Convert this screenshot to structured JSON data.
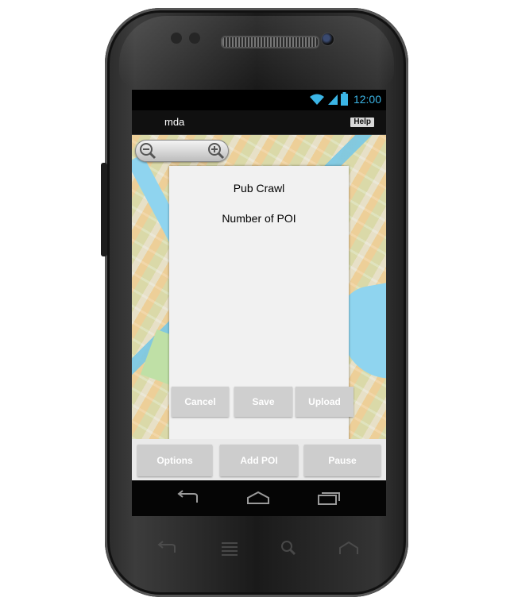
{
  "status_bar": {
    "time": "12:00",
    "icons": [
      "wifi-icon",
      "signal-icon",
      "battery-icon"
    ],
    "accent_color": "#3bb5e6"
  },
  "app_bar": {
    "title": "mda",
    "help_label": "Help"
  },
  "map": {
    "zoom_controls": [
      "zoom-out-icon",
      "zoom-in-icon"
    ]
  },
  "dialog": {
    "title": "Pub Crawl",
    "subtitle": "Number of POI",
    "buttons": {
      "cancel": "Cancel",
      "save": "Save",
      "upload": "Upload"
    }
  },
  "action_bar": {
    "options": "Options",
    "add_poi": "Add POI",
    "pause": "Pause"
  },
  "nav_bar": {
    "icons": [
      "back-icon",
      "home-icon",
      "recent-apps-icon"
    ]
  },
  "hardware_keys": {
    "icons": [
      "back-icon",
      "menu-icon",
      "search-icon",
      "home-icon"
    ]
  }
}
